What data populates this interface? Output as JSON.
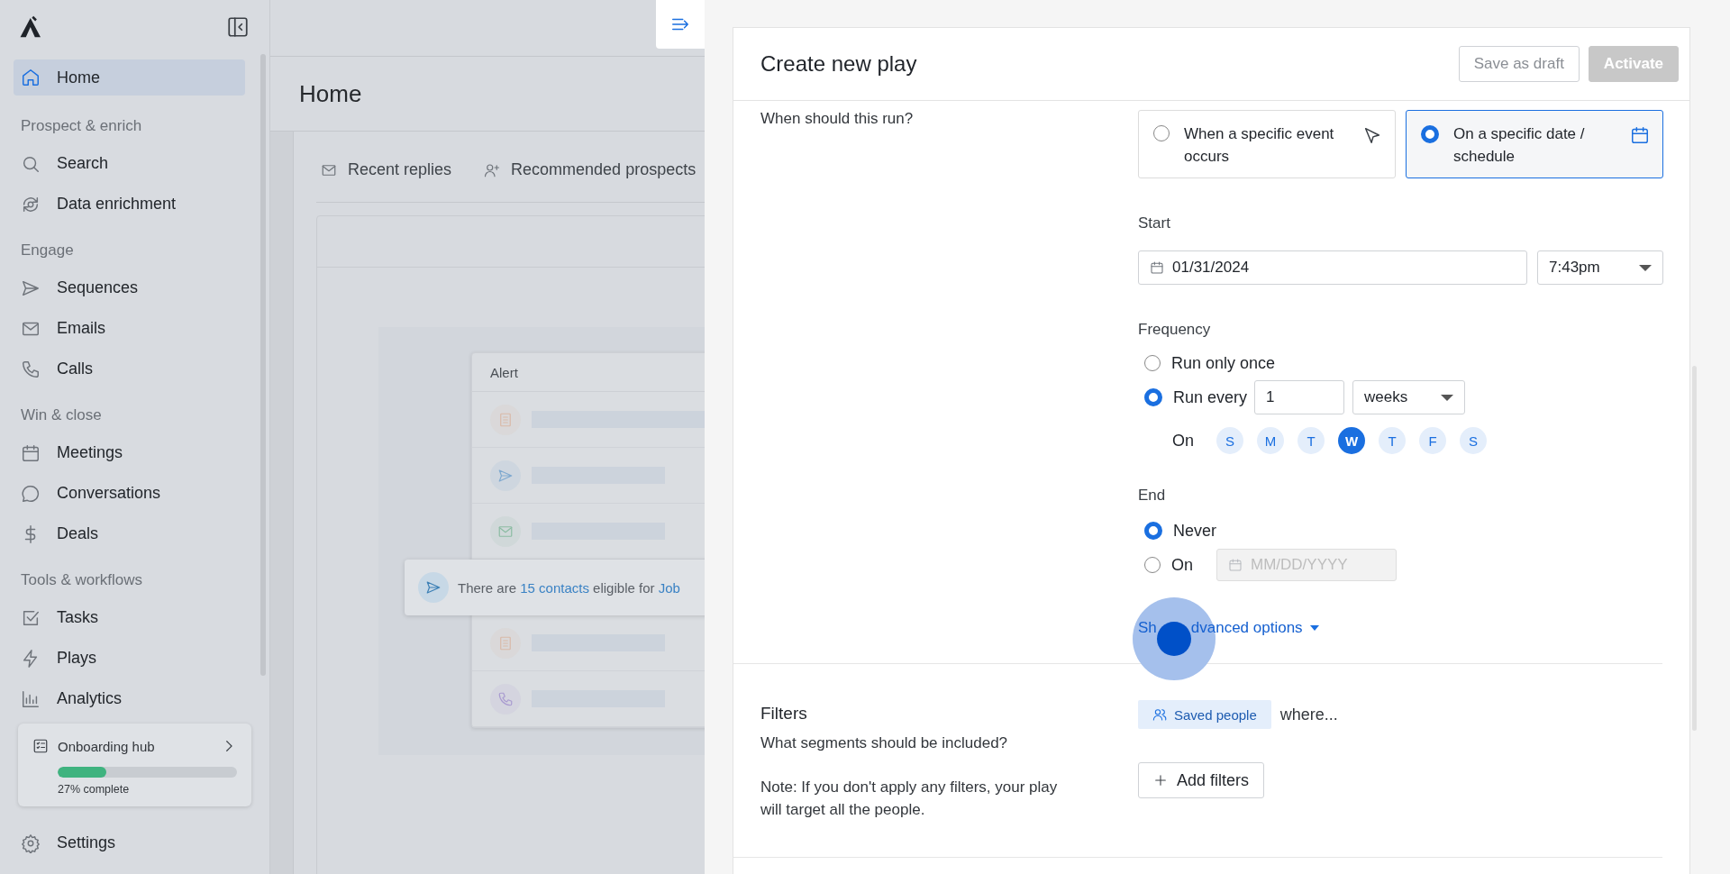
{
  "sidebar": {
    "items": [
      {
        "kind": "nav",
        "label": "Home",
        "selected": true
      },
      {
        "kind": "section",
        "label": "Prospect & enrich"
      },
      {
        "kind": "nav",
        "label": "Search",
        "selected": false
      },
      {
        "kind": "nav",
        "label": "Data enrichment",
        "selected": false
      },
      {
        "kind": "section",
        "label": "Engage"
      },
      {
        "kind": "nav",
        "label": "Sequences",
        "selected": false
      },
      {
        "kind": "nav",
        "label": "Emails",
        "selected": false
      },
      {
        "kind": "nav",
        "label": "Calls",
        "selected": false
      },
      {
        "kind": "section",
        "label": "Win & close"
      },
      {
        "kind": "nav",
        "label": "Meetings",
        "selected": false
      },
      {
        "kind": "nav",
        "label": "Conversations",
        "selected": false
      },
      {
        "kind": "nav",
        "label": "Deals",
        "selected": false
      },
      {
        "kind": "section",
        "label": "Tools & workflows"
      },
      {
        "kind": "nav",
        "label": "Tasks",
        "selected": false
      },
      {
        "kind": "nav",
        "label": "Plays",
        "selected": false
      },
      {
        "kind": "nav",
        "label": "Analytics",
        "selected": false
      }
    ],
    "onboarding": {
      "title": "Onboarding hub",
      "level": 0.27,
      "caption": "27% complete"
    },
    "footer_items": [
      {
        "label": "Settings",
        "selected": false
      }
    ]
  },
  "main": {
    "title": "Home",
    "tabs": [
      {
        "label": "Recent replies"
      },
      {
        "label": "Recommended prospects"
      }
    ],
    "alert": {
      "title": "Alert",
      "rows": [
        {
          "color": "#d9b9a8",
          "kind": "long"
        },
        {
          "color": "#7fa9cf",
          "kind": "short"
        },
        {
          "color": "#8cbca3",
          "kind": "short"
        },
        {
          "color": "#d9b9a8",
          "kind": "short"
        },
        {
          "color": "#a99bd0",
          "kind": "short"
        }
      ]
    },
    "toast": {
      "parts": [
        {
          "kind": "plain",
          "text": "There are"
        },
        {
          "kind": "link",
          "text": "15 contacts"
        },
        {
          "kind": "plain",
          "text": "eligible for"
        },
        {
          "kind": "link",
          "text": "Job"
        }
      ]
    }
  },
  "panel": {
    "title": "Create new play",
    "actions": [
      {
        "label": "Save as draft",
        "kind": "secondary",
        "disabled": false
      },
      {
        "label": "Activate",
        "kind": "primary",
        "disabled": true
      }
    ],
    "trigger": {
      "question": "When should this run?",
      "options": [
        {
          "label": "When a specific event occurs",
          "selected": false
        },
        {
          "label": "On a specific date / schedule",
          "selected": true
        }
      ]
    },
    "start": {
      "label": "Start",
      "date": "01/31/2024",
      "time": "7:43pm"
    },
    "frequency": {
      "label": "Frequency",
      "options": [
        {
          "kind": "once",
          "label": "Run only once",
          "selected": false
        },
        {
          "kind": "every",
          "label": "Run every",
          "selected": true,
          "interval": "1",
          "unit": "weeks"
        }
      ],
      "days_label": "On",
      "days": [
        {
          "label": "S",
          "selected": false
        },
        {
          "label": "M",
          "selected": false
        },
        {
          "label": "T",
          "selected": false
        },
        {
          "label": "W",
          "selected": true
        },
        {
          "label": "T",
          "selected": false
        },
        {
          "label": "F",
          "selected": false
        },
        {
          "label": "S",
          "selected": false
        }
      ]
    },
    "end": {
      "label": "End",
      "options": [
        {
          "kind": "never",
          "label": "Never",
          "selected": true
        },
        {
          "kind": "date",
          "label": "On",
          "selected": false,
          "placeholder": "MM/DD/YYYY",
          "disabled": true
        }
      ]
    },
    "advanced": {
      "parts": [
        "Sh",
        "dvanced options"
      ]
    },
    "filters": {
      "title": "Filters",
      "subtitle": "What segments should be included?",
      "note": "Note: If you don't apply any filters, your play will target all the people.",
      "segment": "Saved people",
      "where": "where...",
      "add_button": "Add filters"
    }
  }
}
